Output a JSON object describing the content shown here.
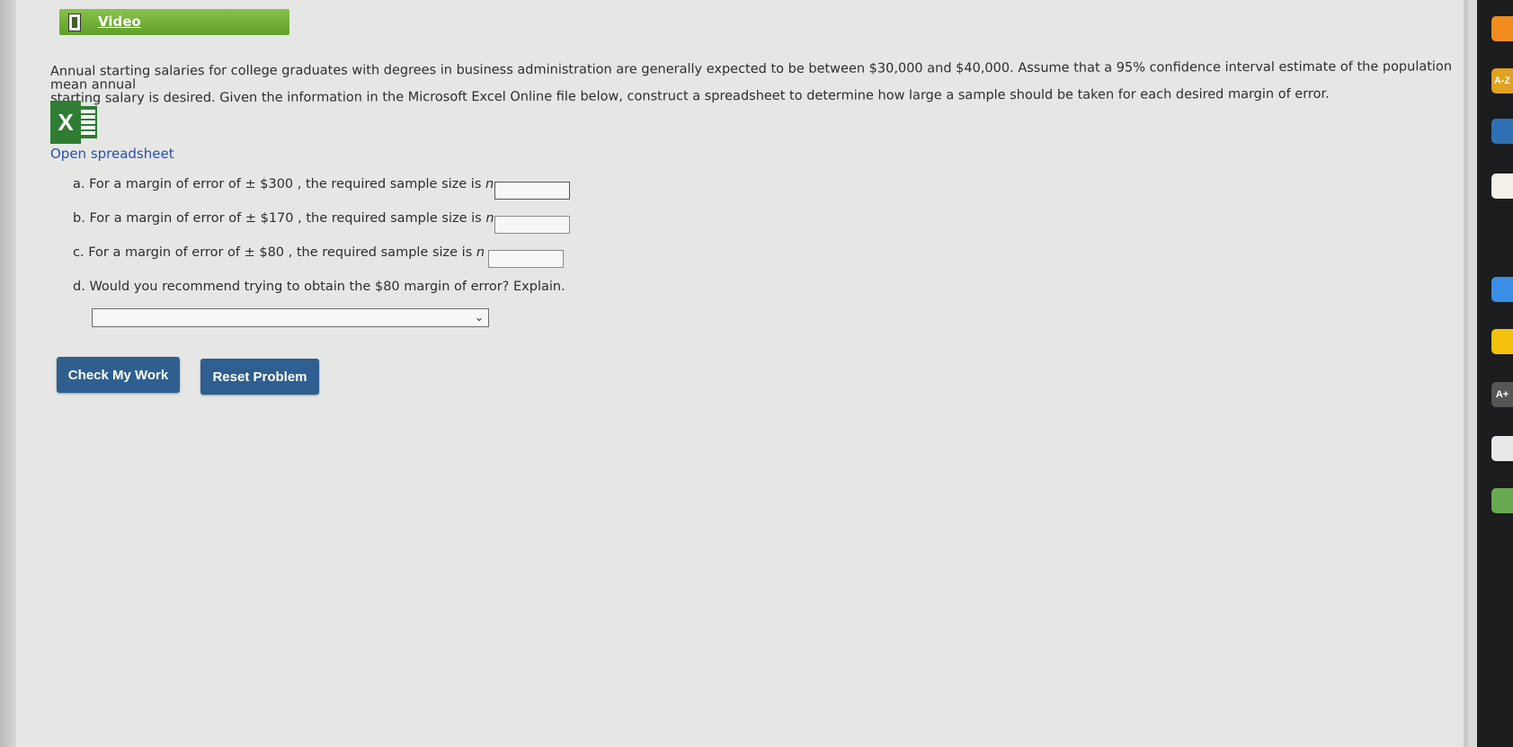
{
  "video": {
    "label": "Video"
  },
  "problem": {
    "text_line1": "Annual starting salaries for college graduates with degrees in business administration are generally expected to be between $30,000 and $40,000. Assume that a 95% confidence interval estimate of the population mean annual",
    "text_line2": "starting salary is desired. Given the information in the Microsoft Excel Online file below, construct a spreadsheet to determine how large a sample should be taken for each desired margin of error."
  },
  "spreadsheet": {
    "icon_letter": "X",
    "link_label": "Open spreadsheet"
  },
  "questions": [
    {
      "letter": "a.",
      "prefix": "For a margin of error of ± $300 , the required sample size is",
      "var": "n",
      "eq": "=",
      "value": ""
    },
    {
      "letter": "b.",
      "prefix": "For a margin of error of ± $170 , the required sample size is",
      "var": "n",
      "eq": "=",
      "value": ""
    },
    {
      "letter": "c.",
      "prefix": "For a margin of error of ± $80 , the required sample size is",
      "var": "n",
      "eq": "=",
      "value": ""
    },
    {
      "letter": "d.",
      "prefix": "Would you recommend trying to obtain the $80 margin of error? Explain."
    }
  ],
  "dropdown": {
    "selected": ""
  },
  "buttons": {
    "check": "Check My Work",
    "reset": "Reset Problem"
  },
  "dock": {
    "icons": [
      {
        "name": "rss-icon",
        "color": "#f28c1e",
        "label": ""
      },
      {
        "name": "a-z-icon",
        "color": "#e0a020",
        "label": "A-Z"
      },
      {
        "name": "book-icon",
        "color": "#2f6fb3",
        "label": ""
      },
      {
        "name": "notes-icon",
        "color": "#f4f1e8",
        "label": ""
      },
      {
        "name": "speech-icon",
        "color": "#1b1c1e",
        "label": ""
      },
      {
        "name": "onedrive-icon",
        "color": "#3a8ee6",
        "label": ""
      },
      {
        "name": "google-drive-icon",
        "color": "#f4c20d",
        "label": ""
      },
      {
        "name": "a-plus-icon",
        "color": "#555555",
        "label": "A+"
      },
      {
        "name": "scanner-icon",
        "color": "#e8e8e8",
        "label": ""
      },
      {
        "name": "ring-icon",
        "color": "#6aa84f",
        "label": ""
      }
    ]
  }
}
